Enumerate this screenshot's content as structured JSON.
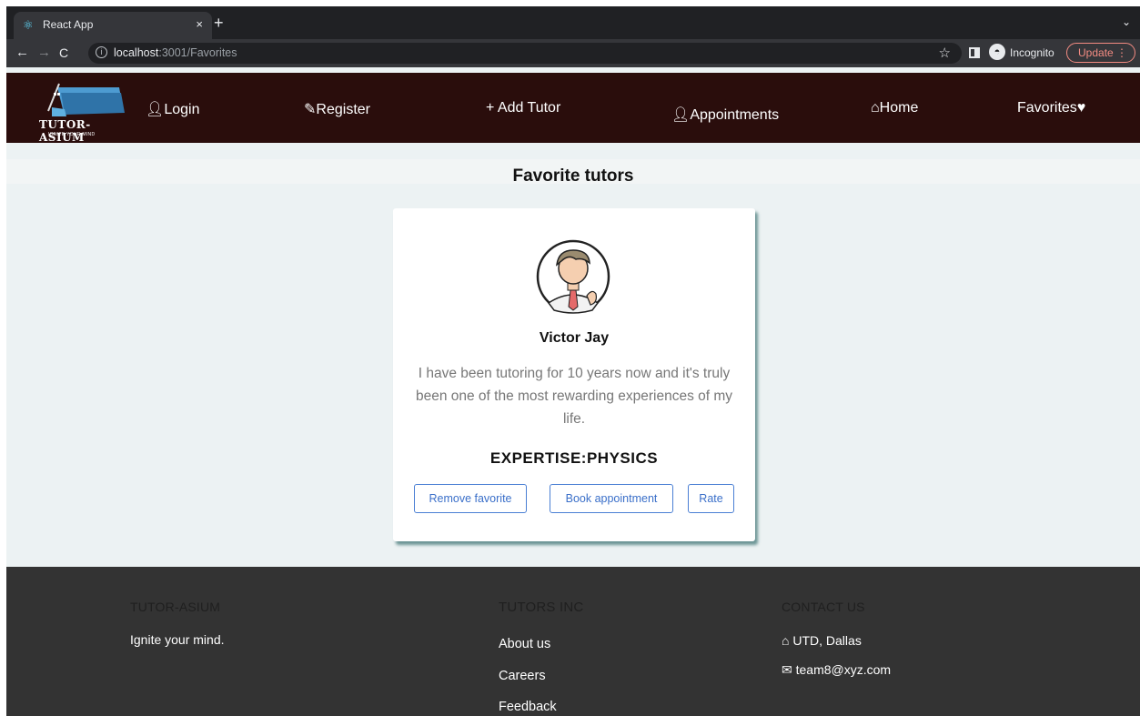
{
  "browser": {
    "tab_title": "React App",
    "tab_close": "×",
    "new_tab": "+",
    "url_host": "localhost",
    "url_path": ":3001/Favorites",
    "incognito_label": "Incognito",
    "update_label": "Update"
  },
  "navbar": {
    "logo_text": "TUTOR-ASIUM",
    "logo_tagline": "IGNITE YOUR MIND",
    "login": "Login",
    "register": "Register",
    "add_tutor": "+ Add Tutor",
    "appointments": "Appointments",
    "home": "Home",
    "favorites": "Favorites"
  },
  "main": {
    "heading": "Favorite tutors",
    "tutor": {
      "name": "Victor Jay",
      "bio": "I have been tutoring for 10 years now and it's truly been one of the most rewarding experiences of my life.",
      "expertise": "EXPERTISE:PHYSICS",
      "remove_favorite": "Remove favorite",
      "book_appointment": "Book appointment",
      "rate": "Rate"
    }
  },
  "footer": {
    "col1_heading": "TUTOR-ASIUM",
    "col1_text": "Ignite your mind.",
    "col2_heading": "TUTORS INC",
    "col2_links": [
      "About us",
      "Careers",
      "Feedback"
    ],
    "col3_heading": "CONTACT US",
    "col3_address": "UTD, Dallas",
    "col3_email": "team8@xyz.com"
  },
  "colors": {
    "navbar_bg": "#2a0d0c",
    "page_bg": "#ecf2f3",
    "footer_bg": "#333333",
    "button_accent": "#3a6fc9",
    "card_shadow": "#2f6b6b"
  }
}
